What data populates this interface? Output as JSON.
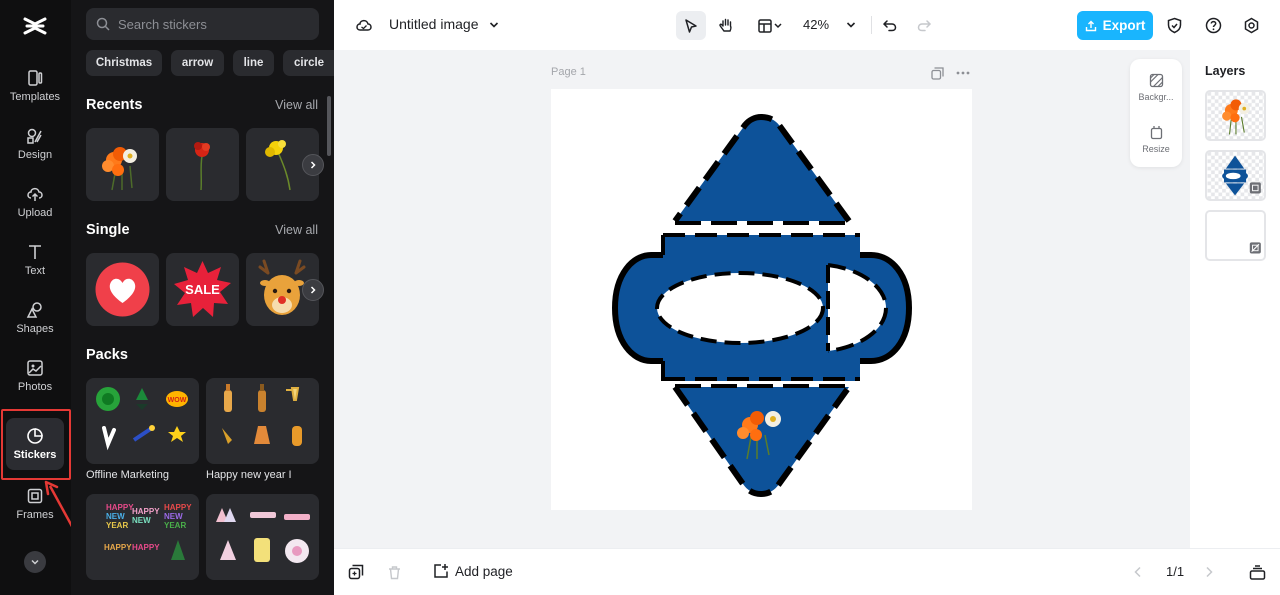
{
  "rail": {
    "items": [
      {
        "label": "Templates",
        "icon": "templates-icon"
      },
      {
        "label": "Design",
        "icon": "design-icon"
      },
      {
        "label": "Upload",
        "icon": "upload-icon"
      },
      {
        "label": "Text",
        "icon": "text-icon"
      },
      {
        "label": "Shapes",
        "icon": "shapes-icon"
      },
      {
        "label": "Photos",
        "icon": "photos-icon"
      },
      {
        "label": "Stickers",
        "icon": "stickers-icon",
        "active": true
      },
      {
        "label": "Frames",
        "icon": "frames-icon"
      }
    ],
    "highlight_color": "#e53935"
  },
  "panel": {
    "search_placeholder": "Search stickers",
    "chips": [
      "Christmas",
      "arrow",
      "line",
      "circle"
    ],
    "recents": {
      "title": "Recents",
      "view_all": "View all"
    },
    "single": {
      "title": "Single",
      "view_all": "View all",
      "sale_text": "SALE"
    },
    "packs": {
      "title": "Packs",
      "items": [
        "Offline Marketing",
        "Happy new year I"
      ]
    }
  },
  "topbar": {
    "doc_title": "Untitled image",
    "zoom": "42%",
    "export_label": "Export",
    "export_color": "#19b5fe"
  },
  "stage": {
    "page_label": "Page 1",
    "tools": [
      {
        "label": "Backgr...",
        "icon": "background-icon"
      },
      {
        "label": "Resize",
        "icon": "resize-icon"
      }
    ],
    "shape_color": "#0d5299"
  },
  "layers": {
    "title": "Layers"
  },
  "bottombar": {
    "add_page": "Add page",
    "page_count": "1/1"
  }
}
